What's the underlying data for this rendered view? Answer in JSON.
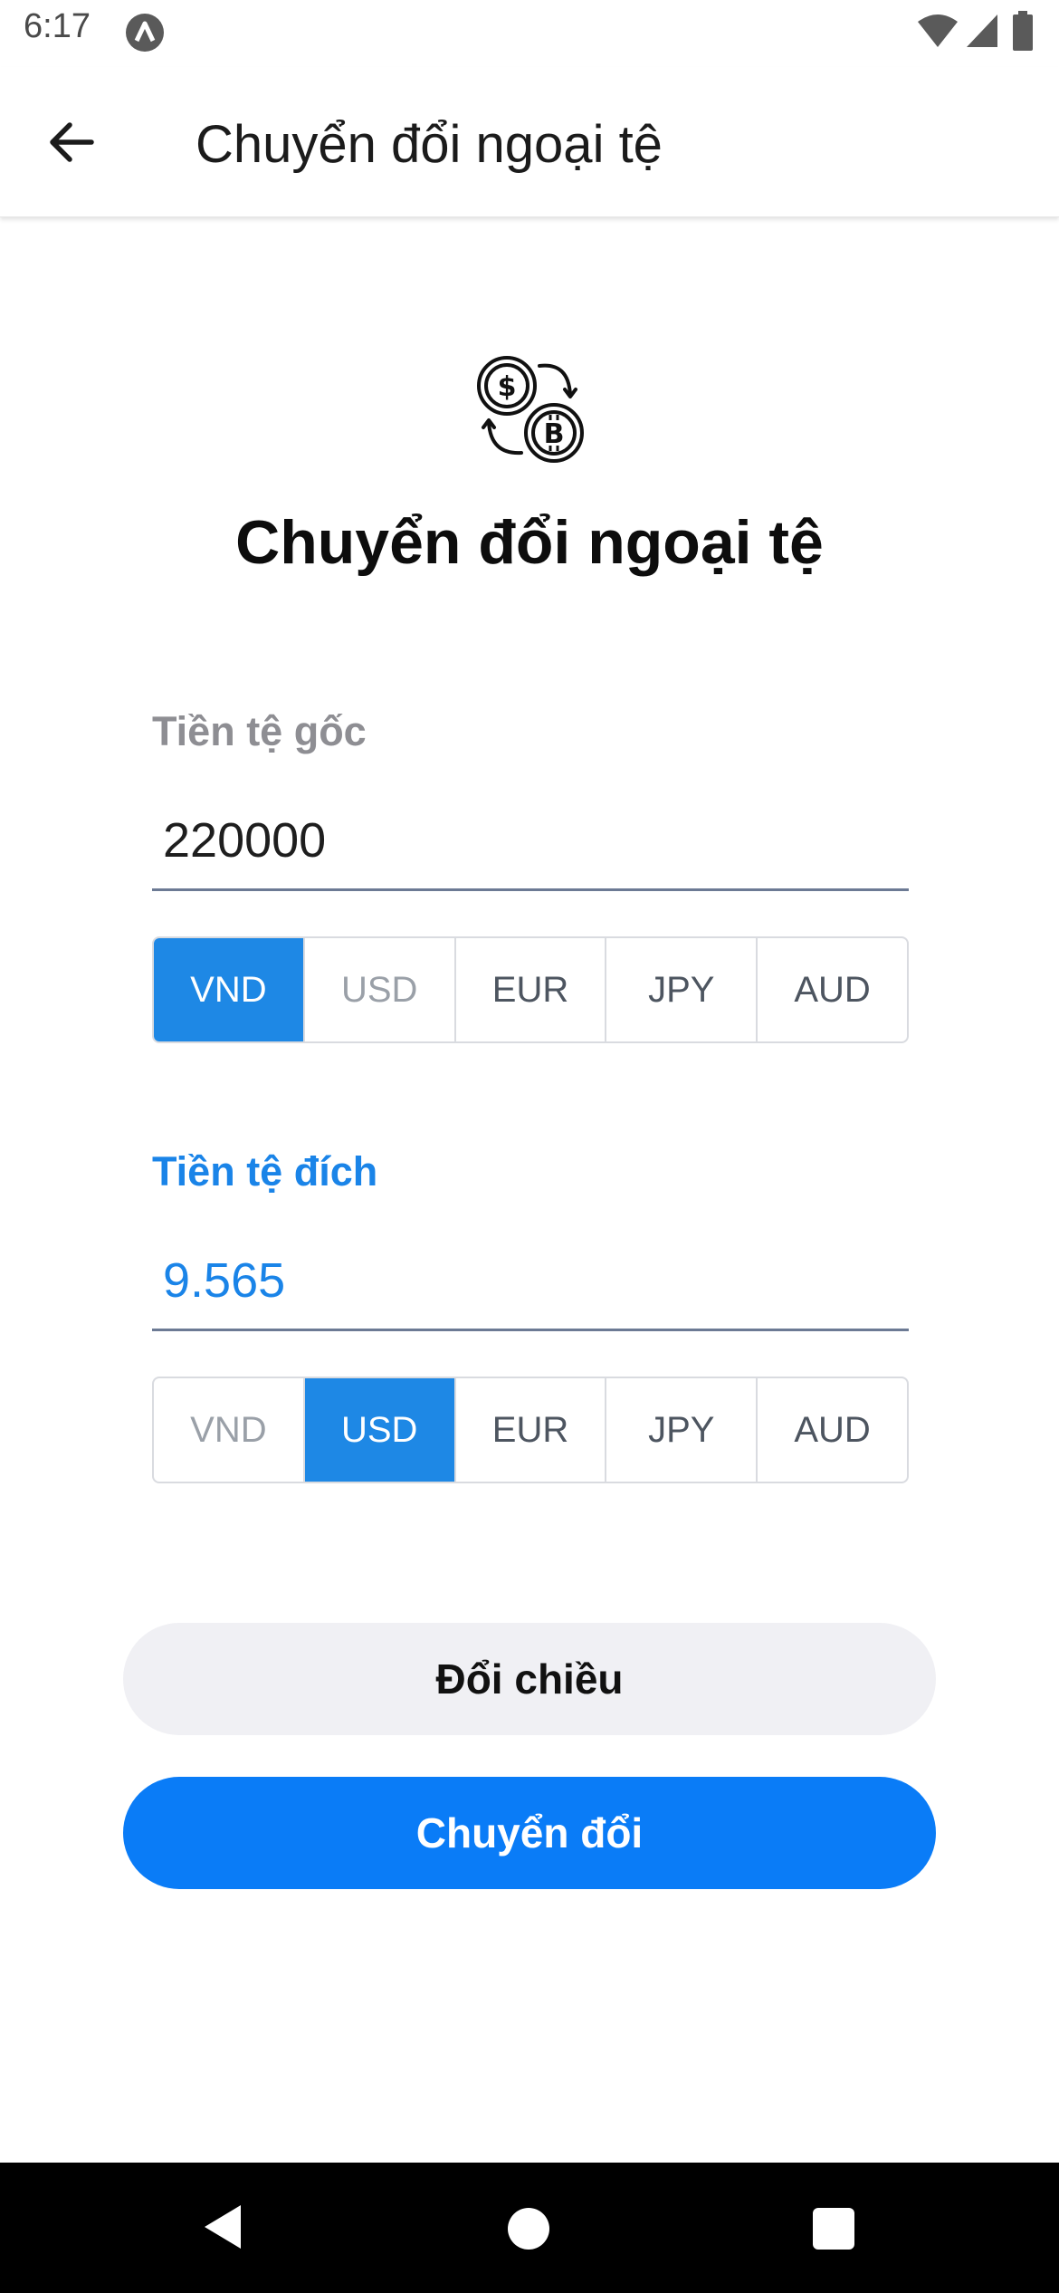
{
  "status_bar": {
    "time": "6:17",
    "app_icon": "a-letter-icon",
    "wifi_icon": "wifi-icon",
    "signal_icon": "cell-signal-icon",
    "battery_icon": "battery-icon"
  },
  "app_bar": {
    "back_icon": "arrow-left-icon",
    "title": "Chuyển đổi ngoại tệ"
  },
  "hero": {
    "icon": "currency-exchange-icon",
    "title": "Chuyển đổi ngoại tệ"
  },
  "source": {
    "label": "Tiền tệ gốc",
    "value": "220000",
    "currencies": [
      "VND",
      "USD",
      "EUR",
      "JPY",
      "AUD"
    ],
    "selected": "VND",
    "disabled": "USD"
  },
  "target": {
    "label": "Tiền tệ đích",
    "value": "9.565",
    "currencies": [
      "VND",
      "USD",
      "EUR",
      "JPY",
      "AUD"
    ],
    "selected": "USD",
    "disabled": "VND"
  },
  "buttons": {
    "swap": "Đổi chiều",
    "convert": "Chuyển đổi"
  },
  "colors": {
    "accent": "#1e88e5",
    "primary_button": "#0a7cf7",
    "secondary_button": "#f0f0f4",
    "target_label": "#1a84e8"
  },
  "nav_bar": {
    "back_icon": "triangle-back-icon",
    "home_icon": "circle-home-icon",
    "recents_icon": "square-recents-icon"
  }
}
